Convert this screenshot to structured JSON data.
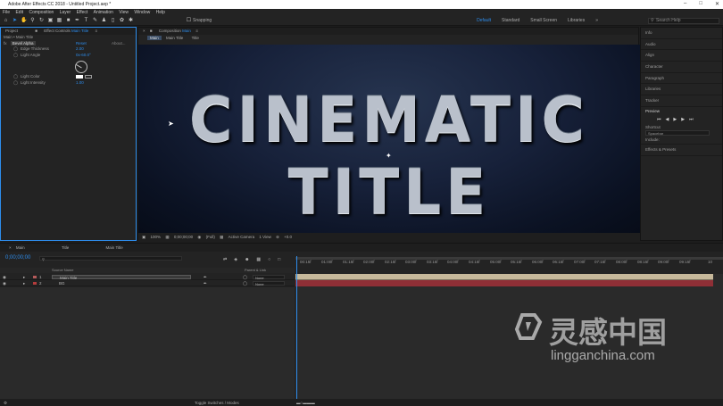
{
  "window": {
    "title": "Adobe After Effects CC 2018 - Untitled Project.aep *"
  },
  "menu": [
    "File",
    "Edit",
    "Composition",
    "Layer",
    "Effect",
    "Animation",
    "View",
    "Window",
    "Help"
  ],
  "toolbar": {
    "snapping_label": "Snapping",
    "workspaces": [
      "Default",
      "Standard",
      "Small Screen",
      "Libraries"
    ],
    "search_placeholder": "Search Help"
  },
  "project_panel": {
    "tab": "Project",
    "effect_tab": "Effect Controls",
    "effect_layer": "Main Title"
  },
  "effect_controls": {
    "breadcrumb": "Main • Main Title",
    "effect_name": "Bevel Alpha",
    "reset_label": "Reset",
    "about_label": "About...",
    "params": [
      {
        "label": "Edge Thickness",
        "value": "2.00"
      },
      {
        "label": "Light Angle",
        "value": "0x-60.0°"
      },
      {
        "label": "Light Color",
        "value": ""
      },
      {
        "label": "Light Intensity",
        "value": "1.00"
      }
    ]
  },
  "composition": {
    "tab_prefix": "Composition",
    "tab_name": "Main",
    "breadcrumbs": [
      "Main",
      "Main Title",
      "Title"
    ],
    "title_text": "CINEMATIC TITLE",
    "viewer": {
      "zoom": "100%",
      "timecode": "0;00;00;00",
      "resolution": "(Full)",
      "camera": "Active Camera",
      "views": "1 View",
      "exposure": "+0.0"
    }
  },
  "right_panel": {
    "items": [
      "Info",
      "Audio",
      "Align",
      "Character",
      "Paragraph",
      "Libraries",
      "Tracker"
    ],
    "preview_label": "Preview",
    "shortcut_label": "Shortcut",
    "shortcut_value": "Spacebar",
    "include_label": "Include:",
    "effects_label": "Effects & Presets"
  },
  "timeline": {
    "tabs": [
      "Main",
      "Title",
      "Main Title"
    ],
    "timecode": "0;00;00;00",
    "column_source": "Source Name",
    "column_parent": "Parent & Link",
    "layers": [
      {
        "num": "1",
        "name": "Main Title",
        "parent": "None",
        "label_color": "#b45a5a"
      },
      {
        "num": "2",
        "name": "BG",
        "parent": "None",
        "label_color": "#b43c3c"
      }
    ],
    "ruler_ticks": [
      "00:15f",
      "01:00f",
      "01:15f",
      "02:00f",
      "02:15f",
      "03:00f",
      "03:15f",
      "04:00f",
      "04:15f",
      "05:00f",
      "05:15f",
      "06:00f",
      "06:15f",
      "07:00f",
      "07:15f",
      "08:00f",
      "08:15f",
      "09:00f",
      "09:15f",
      "10"
    ],
    "footer_label": "Toggle Switches / Modes"
  },
  "watermark": {
    "chinese": "灵感中国",
    "url": "lingganchina.com"
  },
  "colors": {
    "accent": "#2d8ceb",
    "bar_title": "#c6b89a",
    "bar_bg": "#8f2f36"
  }
}
